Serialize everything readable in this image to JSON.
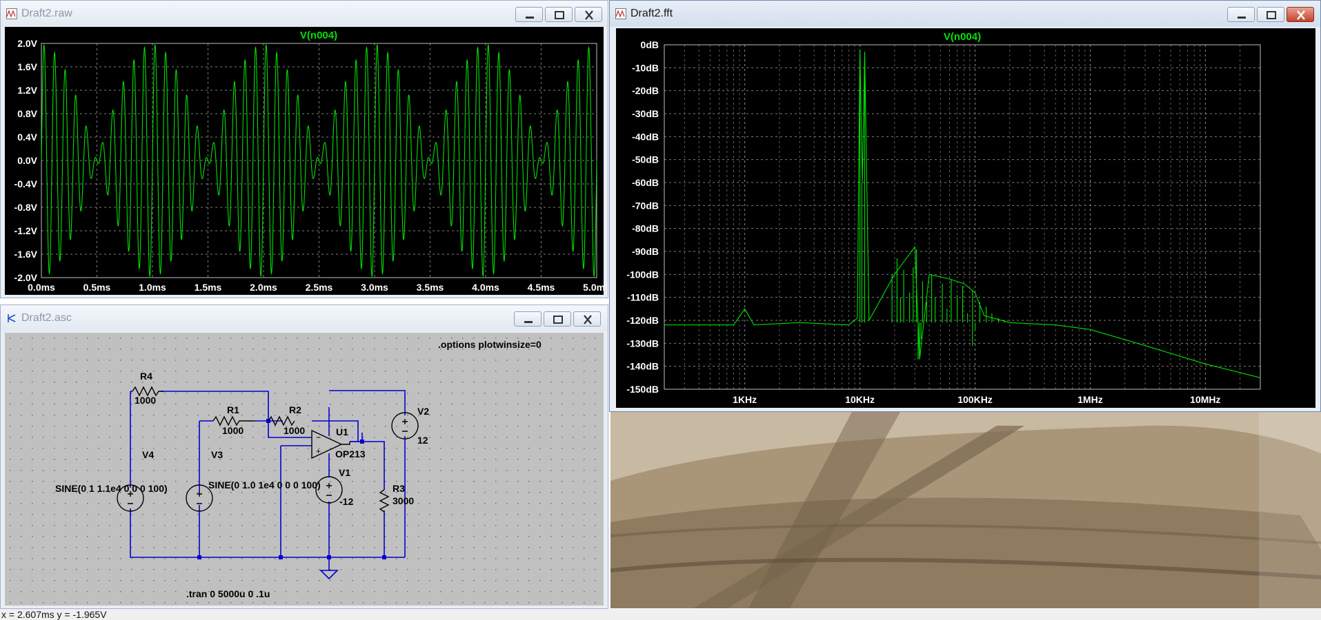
{
  "raw_window": {
    "title": "Draft2.raw",
    "icon": "waveform-plot-icon",
    "trace_label": "V(n004)",
    "y_ticks": [
      "2.0V",
      "1.6V",
      "1.2V",
      "0.8V",
      "0.4V",
      "0.0V",
      "-0.4V",
      "-0.8V",
      "-1.2V",
      "-1.6V",
      "-2.0V"
    ],
    "x_ticks": [
      "0.0ms",
      "0.5ms",
      "1.0ms",
      "1.5ms",
      "2.0ms",
      "2.5ms",
      "3.0ms",
      "3.5ms",
      "4.0ms",
      "4.5ms",
      "5.0ms"
    ]
  },
  "fft_window": {
    "title": "Draft2.fft",
    "icon": "waveform-plot-icon",
    "trace_label": "V(n004)",
    "y_ticks": [
      "0dB",
      "-10dB",
      "-20dB",
      "-30dB",
      "-40dB",
      "-50dB",
      "-60dB",
      "-70dB",
      "-80dB",
      "-90dB",
      "-100dB",
      "-110dB",
      "-120dB",
      "-130dB",
      "-140dB",
      "-150dB"
    ],
    "x_ticks": [
      "1KHz",
      "10KHz",
      "100KHz",
      "1MHz",
      "10MHz"
    ]
  },
  "schematic_window": {
    "title": "Draft2.asc",
    "icon": "schematic-icon",
    "options_directive": ".options plotwinsize=0",
    "tran_directive": ".tran 0 5000u 0 .1u",
    "components": {
      "r4": {
        "name": "R4",
        "value": "1000"
      },
      "r1": {
        "name": "R1",
        "value": "1000"
      },
      "r2": {
        "name": "R2",
        "value": "1000"
      },
      "r3": {
        "name": "R3",
        "value": "3000"
      },
      "u1": {
        "name": "U1",
        "value": "OP213"
      },
      "v1": {
        "name": "V1",
        "value": "-12"
      },
      "v2": {
        "name": "V2",
        "value": "12"
      },
      "v3": {
        "name": "V3",
        "value": "SINE(0 1.0 1e4 0 0 0 100)"
      },
      "v4": {
        "name": "V4",
        "value": "SINE(0 1 1.1e4 0 0 0 100)"
      }
    }
  },
  "status_bar": {
    "text": "x = 2.607ms   y = -1.965V"
  },
  "colors": {
    "trace": "#00e000",
    "wire": "#0000d0",
    "plot_bg": "#000000",
    "schematic_bg": "#c0c0c0",
    "grid": "#808080"
  },
  "chart_data": [
    {
      "type": "line",
      "title": "V(n004)",
      "xlabel": "",
      "ylabel": "",
      "xlim": [
        0,
        5.0
      ],
      "ylim": [
        -2.0,
        2.0
      ],
      "series": [
        {
          "name": "V(n004)",
          "description_x_units": "ms",
          "carriers_hz": [
            10000,
            11000
          ],
          "amplitudes": [
            1.0,
            1.0
          ]
        }
      ]
    },
    {
      "type": "line",
      "title": "V(n004)",
      "xlabel": "",
      "ylabel": "",
      "x_scale": "log",
      "xlim": [
        200,
        30000000
      ],
      "ylim": [
        -150,
        0
      ],
      "series": [
        {
          "name": "V(n004)",
          "points": [
            [
              200,
              -122
            ],
            [
              800,
              -122
            ],
            [
              1000,
              -115
            ],
            [
              1200,
              -122
            ],
            [
              3000,
              -121
            ],
            [
              8000,
              -122
            ],
            [
              9500,
              -119
            ],
            [
              10000,
              -2
            ],
            [
              10500,
              -60
            ],
            [
              11000,
              -3
            ],
            [
              12000,
              -120
            ],
            [
              20000,
              -100
            ],
            [
              30000,
              -88
            ],
            [
              33000,
              -137
            ],
            [
              40000,
              -100
            ],
            [
              60000,
              -102
            ],
            [
              80000,
              -104
            ],
            [
              100000,
              -108
            ],
            [
              120000,
              -118
            ],
            [
              200000,
              -121
            ],
            [
              500000,
              -122
            ],
            [
              1000000,
              -124
            ],
            [
              3000000,
              -131
            ],
            [
              10000000,
              -139
            ],
            [
              30000000,
              -145
            ]
          ]
        }
      ]
    }
  ]
}
